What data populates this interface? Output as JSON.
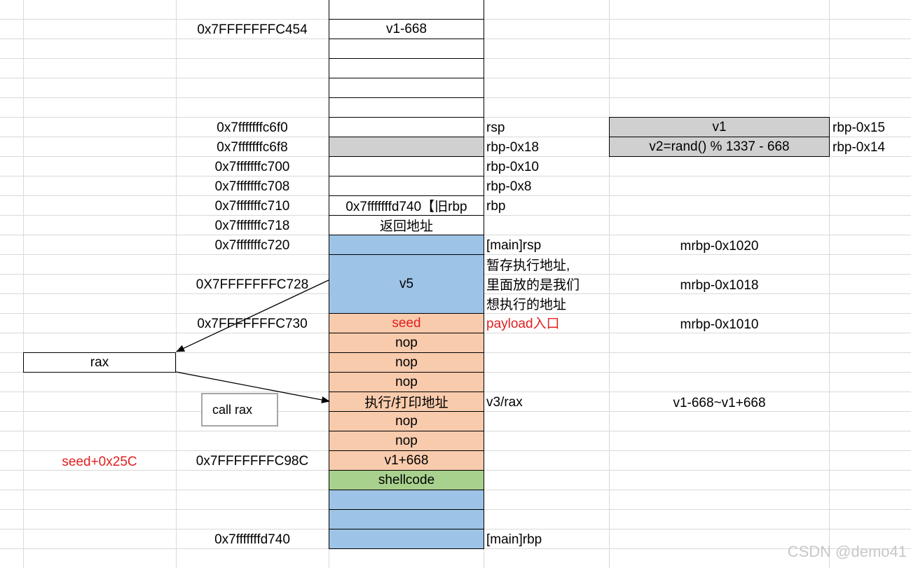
{
  "colors": {
    "white": "#ffffff",
    "gray": "#d0d0d0",
    "blue": "#9dc3e6",
    "peach": "#f8cbad",
    "green": "#a9d18e",
    "red_text": "#e02020",
    "grid": "#d9d9d9"
  },
  "stack": [
    {
      "addr": "",
      "content": "",
      "fill": "white",
      "side": ""
    },
    {
      "addr": "0x7FFFFFFFC454",
      "content": "v1-668",
      "fill": "white",
      "side": ""
    },
    {
      "addr": "",
      "content": "",
      "fill": "white",
      "side": ""
    },
    {
      "addr": "",
      "content": "",
      "fill": "white",
      "side": ""
    },
    {
      "addr": "",
      "content": "",
      "fill": "white",
      "side": ""
    },
    {
      "addr": "",
      "content": "",
      "fill": "white",
      "side": ""
    },
    {
      "addr": "0x7fffffffc6f0",
      "content": "",
      "fill": "white",
      "side": "rsp"
    },
    {
      "addr": "0x7fffffffc6f8",
      "content": "",
      "fill": "gray",
      "side": "rbp-0x18"
    },
    {
      "addr": "0x7fffffffc700",
      "content": "",
      "fill": "white",
      "side": "rbp-0x10"
    },
    {
      "addr": "0x7fffffffc708",
      "content": "",
      "fill": "white",
      "side": "rbp-0x8"
    },
    {
      "addr": "0x7fffffffc710",
      "content": "0x7fffffffd740【旧rbp",
      "fill": "white",
      "side": "rbp"
    },
    {
      "addr": "0x7fffffffc718",
      "content": "返回地址",
      "fill": "white",
      "side": ""
    },
    {
      "addr": "0x7fffffffc720",
      "content": "",
      "fill": "blue",
      "side": "[main]rsp"
    },
    {
      "addr": "0X7FFFFFFFC728",
      "content": "v5",
      "fill": "blue",
      "side": ""
    },
    {
      "addr": "0x7FFFFFFFC730",
      "content": "seed",
      "fill": "peach",
      "side": "payload入口",
      "red": true
    },
    {
      "addr": "",
      "content": "nop",
      "fill": "peach",
      "side": ""
    },
    {
      "addr": "",
      "content": "nop",
      "fill": "peach",
      "side": ""
    },
    {
      "addr": "",
      "content": "nop",
      "fill": "peach",
      "side": ""
    },
    {
      "addr": "",
      "content": "执行/打印地址",
      "fill": "peach",
      "side": "v3/rax"
    },
    {
      "addr": "",
      "content": "nop",
      "fill": "peach",
      "side": ""
    },
    {
      "addr": "",
      "content": "nop",
      "fill": "peach",
      "side": ""
    },
    {
      "addr": "0x7FFFFFFFC98C",
      "content": "v1+668",
      "fill": "peach",
      "side": ""
    },
    {
      "addr": "",
      "content": "shellcode",
      "fill": "green",
      "side": ""
    },
    {
      "addr": "",
      "content": "",
      "fill": "blue",
      "side": ""
    },
    {
      "addr": "",
      "content": "",
      "fill": "blue",
      "side": ""
    },
    {
      "addr": "0x7fffffffd740",
      "content": "",
      "fill": "blue",
      "side": "[main]rbp"
    }
  ],
  "v5_note": [
    "暂存执行地址,",
    "里面放的是我们",
    "想执行的地址"
  ],
  "mrbp": {
    "rsp": "mrbp-0x1020",
    "v5": "mrbp-0x1018",
    "seed": "mrbp-0x1010",
    "exec": "v1-668~v1+668"
  },
  "vars": [
    {
      "content": "v1",
      "label": "rbp-0x15"
    },
    {
      "content": "v2=rand() % 1337 - 668",
      "label": "rbp-0x14"
    }
  ],
  "rax_label": "rax",
  "call_label": "call rax",
  "seed_offset": "seed+0x25C",
  "watermark": "CSDN @demo41"
}
